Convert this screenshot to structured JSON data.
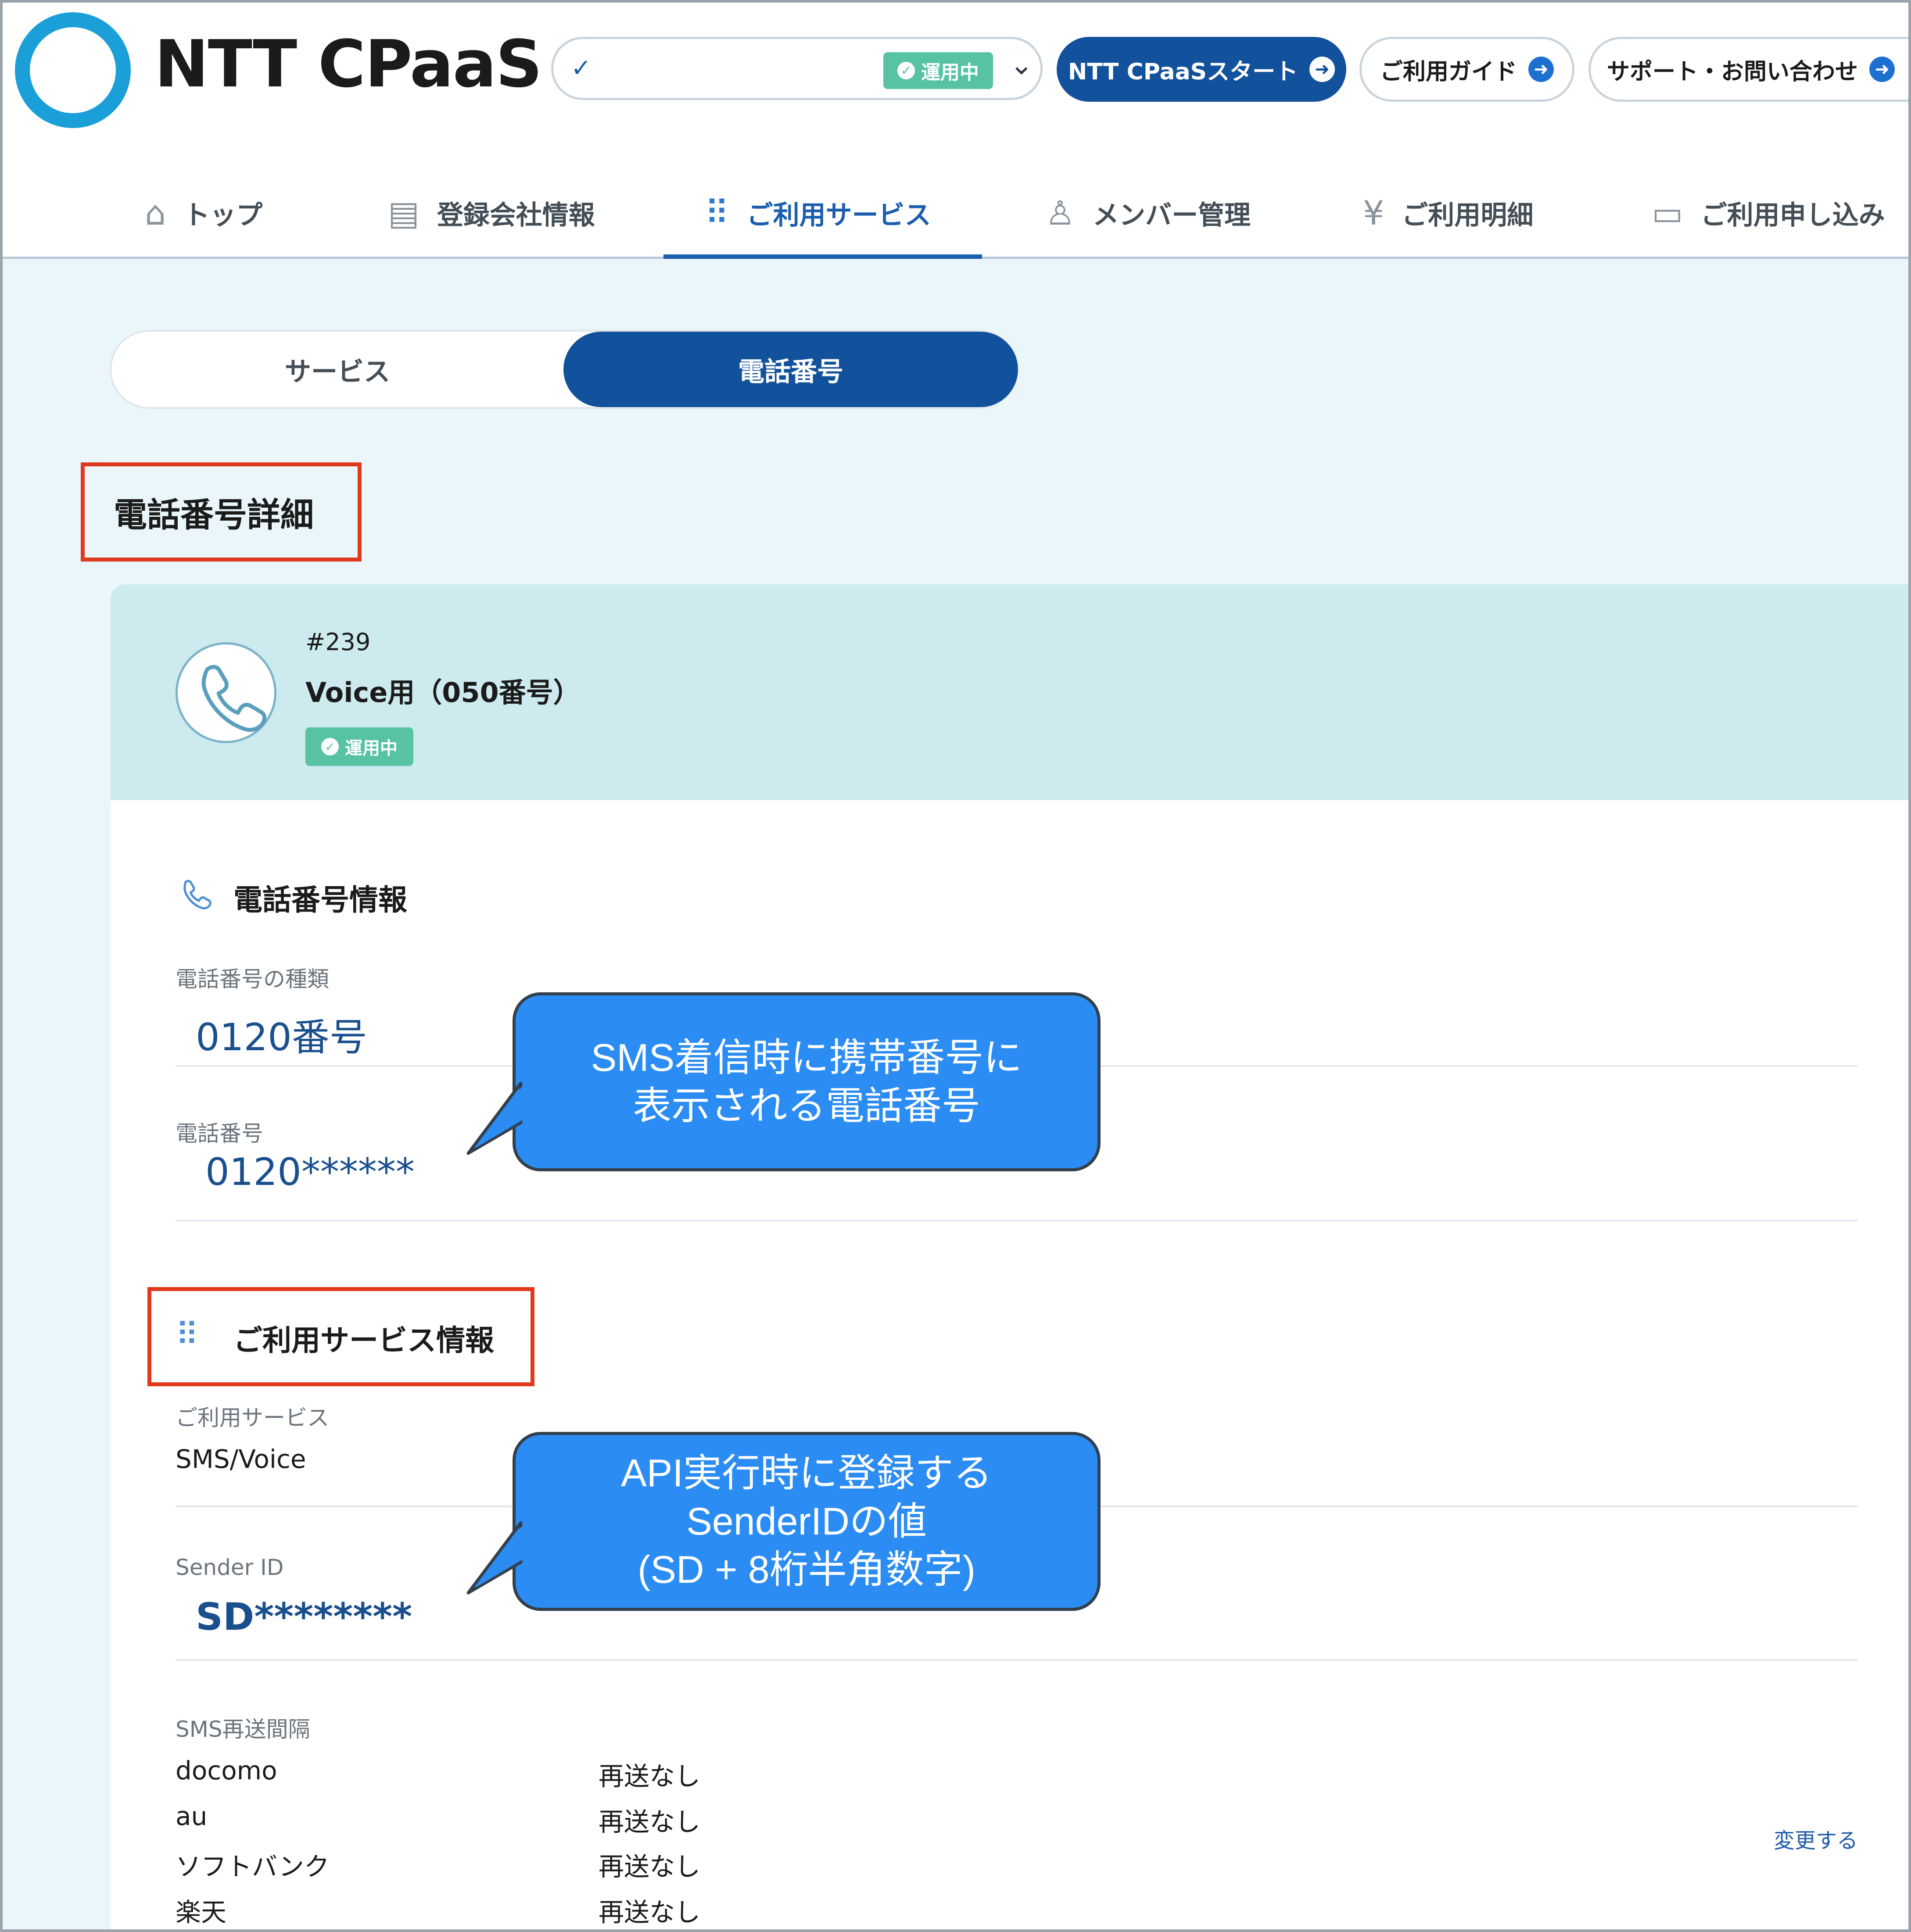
{
  "header": {
    "logo_text": "NTT CPaaS",
    "tenant_check": "✓",
    "tenant_status": "運用中",
    "cpaas_start_label": "NTT CPaaSスタート",
    "guide_label": "ご利用ガイド",
    "support_label": "サポート・お問い合わせ"
  },
  "nav": {
    "items": [
      {
        "label": "トップ",
        "icon": "home-icon"
      },
      {
        "label": "登録会社情報",
        "icon": "document-icon"
      },
      {
        "label": "ご利用サービス",
        "icon": "grid-icon"
      },
      {
        "label": "メンバー管理",
        "icon": "members-icon"
      },
      {
        "label": "ご利用明細",
        "icon": "invoice-icon"
      },
      {
        "label": "ご利用申し込み",
        "icon": "application-icon"
      }
    ],
    "active_index": 2
  },
  "toggle": {
    "service": "サービス",
    "phone": "電話番号",
    "selected": "電話番号"
  },
  "page_title": "電話番号詳細",
  "item": {
    "id": "#239",
    "name": "Voice用（050番号）",
    "status": "運用中"
  },
  "phone_info": {
    "title": "電話番号情報",
    "type_label": "電話番号の種類",
    "type_value": "0120番号",
    "number_label": "電話番号",
    "number_value": "0120******"
  },
  "service_info": {
    "title": "ご利用サービス情報",
    "service_label": "ご利用サービス",
    "service_value": "SMS/Voice",
    "sender_label": "Sender ID",
    "sender_value": "SD********"
  },
  "resend": {
    "label": "SMS再送間隔",
    "rows": [
      {
        "carrier": "docomo",
        "value": "再送なし"
      },
      {
        "carrier": "au",
        "value": "再送なし"
      },
      {
        "carrier": "ソフトバンク",
        "value": "再送なし"
      },
      {
        "carrier": "楽天",
        "value": "再送なし"
      }
    ],
    "change_link": "変更する"
  },
  "callouts": {
    "phone": [
      "SMS着信時に携帯番号に",
      "表示される電話番号"
    ],
    "sender": [
      "API実行時に登録する",
      "SenderIDの値",
      "(SD + 8桁半角数字)"
    ]
  },
  "colors": {
    "brand_blue": "#12519b",
    "logo_cyan": "#1a9fd8",
    "status_green": "#58c3a2",
    "highlight_red": "#e0391e",
    "callout_blue": "#2b8cf3"
  }
}
